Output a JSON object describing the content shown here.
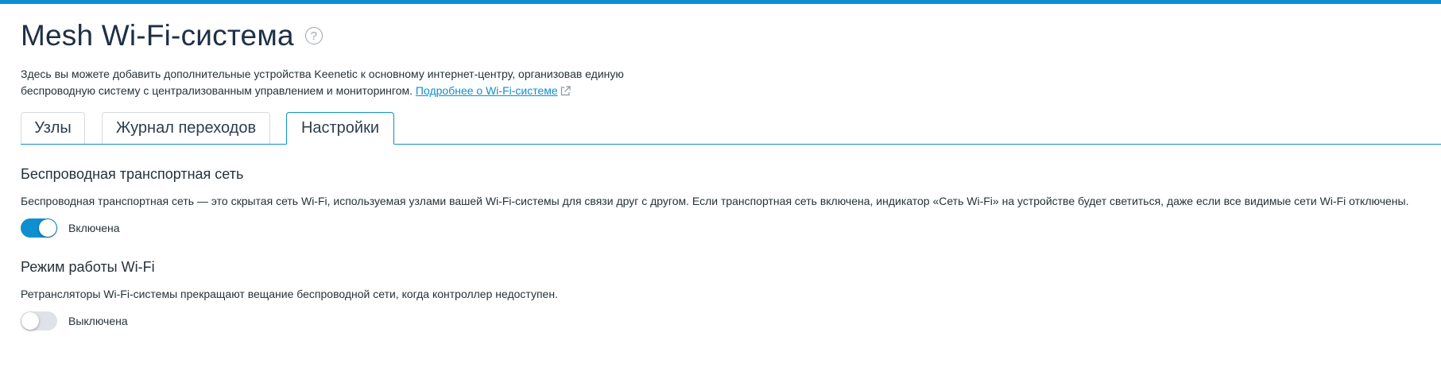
{
  "header": {
    "title": "Mesh Wi-Fi-система",
    "help_icon": "question-circle-icon",
    "intro_text": "Здесь вы можете добавить дополнительные устройства Keenetic к основному интернет-центру, организовав единую беспроводную систему с централизованным управлением и мониторингом.",
    "intro_link": "Подробнее о Wi-Fi-системе",
    "link_icon": "external-link-icon"
  },
  "tabs": [
    {
      "label": "Узлы",
      "active": false
    },
    {
      "label": "Журнал переходов",
      "active": false
    },
    {
      "label": "Настройки",
      "active": true
    }
  ],
  "sections": {
    "backhaul": {
      "title": "Беспроводная транспортная сеть",
      "description": "Беспроводная транспортная сеть — это скрытая сеть Wi-Fi, используемая узлами вашей Wi-Fi-системы для связи друг с другом. Если транспортная сеть включена, индикатор «Сеть Wi-Fi» на устройстве будет светиться, даже если все видимые сети Wi-Fi отключены.",
      "toggle_state": true,
      "toggle_label": "Включена"
    },
    "wifi_mode": {
      "title": "Режим работы Wi-Fi",
      "description": "Ретрансляторы Wi-Fi-системы прекращают вещание беспроводной сети, когда контроллер недоступен.",
      "toggle_state": false,
      "toggle_label": "Выключена"
    }
  },
  "colors": {
    "accent": "#0f8fd1",
    "toggle_off": "#dfe3e7",
    "text": "#263238"
  }
}
